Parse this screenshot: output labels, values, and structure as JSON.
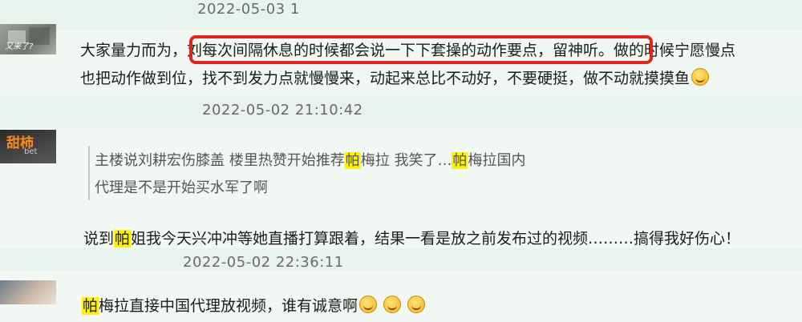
{
  "comments": [
    {
      "timestamp_top": "2022-05-03 1",
      "avatar_label": "又来了?",
      "line1_pre": "大家量力而为，",
      "line1_boxed": "刘每次间隔休息的时候都会说一下下套操的动作要点，留神听。",
      "line1_post": "做的时候宁愿慢点",
      "line2": "也把动作做到位，找不到发力点就慢慢来，动起来总比不动好，不要硬挺，做不动就摸摸鱼",
      "timestamp": "2022-05-02 21:10:42"
    },
    {
      "avatar_label": "甜柿",
      "avatar_sub": "bet",
      "quote_line1_a": "主楼说刘耕宏伤膝盖 楼里热赞开始推荐",
      "quote_hl": "帕",
      "quote_line1_b": "梅拉 我笑了…",
      "quote_line1_c": "梅拉国内",
      "quote_line2": "代理是不是开始买水军了啊",
      "reply_a": "说到",
      "reply_hl": "帕",
      "reply_b": "姐我今天兴冲冲等她直播打算跟着，结果一看是放之前发布过的视频………搞得我好伤心！",
      "timestamp": "2022-05-02 22:36:11"
    },
    {
      "text_hl": "帕",
      "text": "梅拉直接中国代理放视频，谁有诚意啊"
    }
  ],
  "colors": {
    "background": "#e9f3ee",
    "highlight": "#fff200",
    "annotation_box": "#e0261c"
  }
}
